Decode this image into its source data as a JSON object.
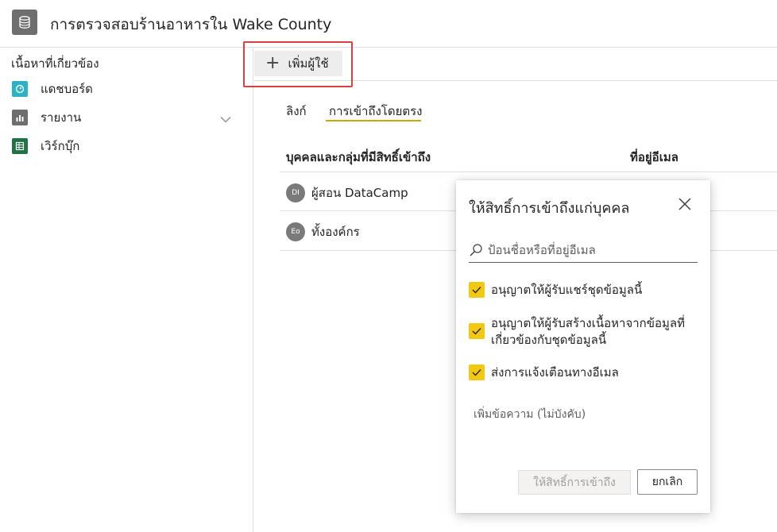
{
  "header": {
    "icon": "dataset-icon",
    "title": "การตรวจสอบร้านอาหารใน Wake County"
  },
  "sidebar": {
    "heading": "เนื้อหาที่เกี่ยวข้อง",
    "items": [
      {
        "label": "แดชบอร์ด",
        "icon": "dashboard-icon",
        "color": "#2ab3c2"
      },
      {
        "label": "รายงาน",
        "icon": "report-icon",
        "color": "#6e6e6e"
      },
      {
        "label": "เวิร์กบุ๊ก",
        "icon": "workbook-icon",
        "color": "#217346"
      }
    ]
  },
  "toolbar": {
    "add_user_label": "เพิ่มผู้ใช้"
  },
  "tabs": [
    {
      "label": "ลิงก์"
    },
    {
      "label": "การเข้าถึงโดยตรง",
      "active": true
    }
  ],
  "table": {
    "columns": [
      "บุคคลและกลุ่มที่มีสิทธิ์เข้าถึง",
      "ที่อยู่อีเมล"
    ],
    "rows": [
      {
        "initials": "DI",
        "name": "ผู้สอน DataCamp"
      },
      {
        "initials": "Eo",
        "name": "ทั้งองค์กร"
      }
    ]
  },
  "dialog": {
    "title": "ให้สิทธิ์การเข้าถึงแก่บุคคล",
    "search_placeholder": "ป้อนชื่อหรือที่อยู่อีเมล",
    "options": [
      {
        "label": "อนุญาตให้ผู้รับแชร์ชุดข้อมูลนี้",
        "checked": true
      },
      {
        "label": "อนุญาตให้ผู้รับสร้างเนื้อหาจากข้อมูลที่เกี่ยวข้องกับชุดข้อมูลนี้",
        "checked": true
      },
      {
        "label": "ส่งการแจ้งเตือนทางอีเมล",
        "checked": true
      }
    ],
    "message_placeholder": "เพิ่มข้อความ (ไม่บังคับ)",
    "grant_label": "ให้สิทธิ์การเข้าถึง",
    "cancel_label": "ยกเลิก"
  },
  "colors": {
    "accent": "#f2c811",
    "highlight": "#d94040"
  }
}
